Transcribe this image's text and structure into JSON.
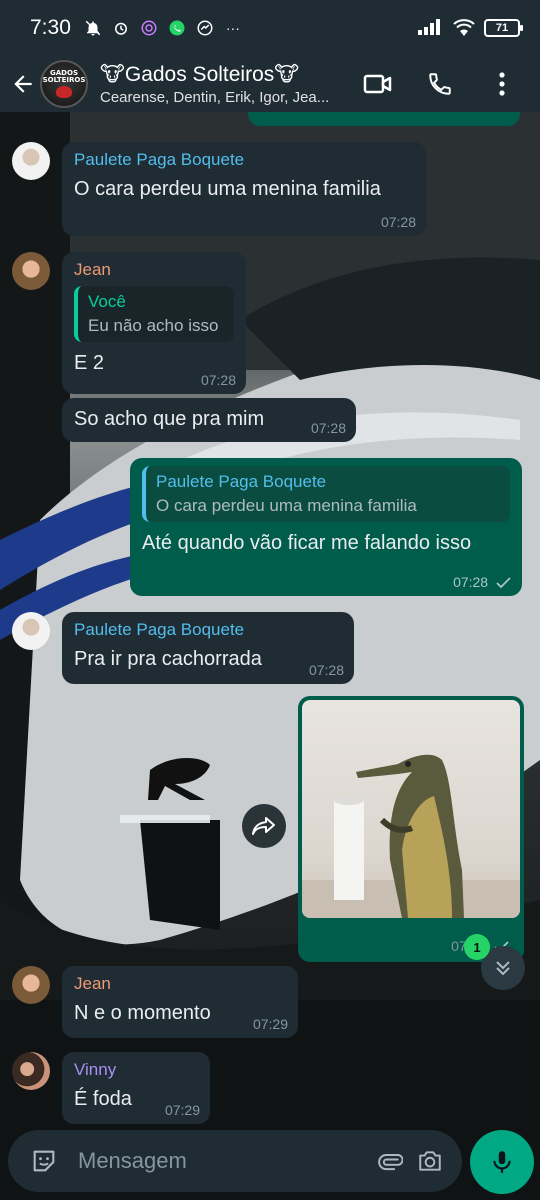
{
  "status_bar": {
    "time": "7:30",
    "battery": "71"
  },
  "header": {
    "title": "🐮Gados Solteiros🐮",
    "members": "Cearense, Dentin, Erik, Igor, Jea...",
    "avatar_text_line1": "GADOS",
    "avatar_text_line2": "SOLTEIROS"
  },
  "messages": [
    {
      "sender": "Paulete Paga Boquete",
      "text": "O cara perdeu uma menina familia",
      "time": "07:28"
    },
    {
      "sender": "Jean",
      "quote_name": "Você",
      "quote_text": "Eu não acho isso",
      "text": "E 2",
      "time": "07:28"
    },
    {
      "text": "So acho que pra mim",
      "time": "07:28"
    },
    {
      "quote_name": "Paulete Paga Boquete",
      "quote_text": "O cara perdeu uma menina familia",
      "text": "Até quando vão ficar me falando isso",
      "time": "07:28"
    },
    {
      "sender": "Paulete Paga Boquete",
      "text": "Pra ir pra cachorrada",
      "time": "07:28"
    },
    {
      "time": "07:29"
    },
    {
      "sender": "Jean",
      "text": "N e o momento",
      "time": "07:29"
    },
    {
      "sender": "Vinny",
      "text": "É foda",
      "time": "07:29"
    }
  ],
  "unread_count": "1",
  "input": {
    "placeholder": "Mensagem"
  },
  "colors": {
    "header_bg": "#1f2c34",
    "incoming_bubble": "#1f2c34",
    "outgoing_bubble": "#005c4b",
    "accent": "#00a884"
  }
}
